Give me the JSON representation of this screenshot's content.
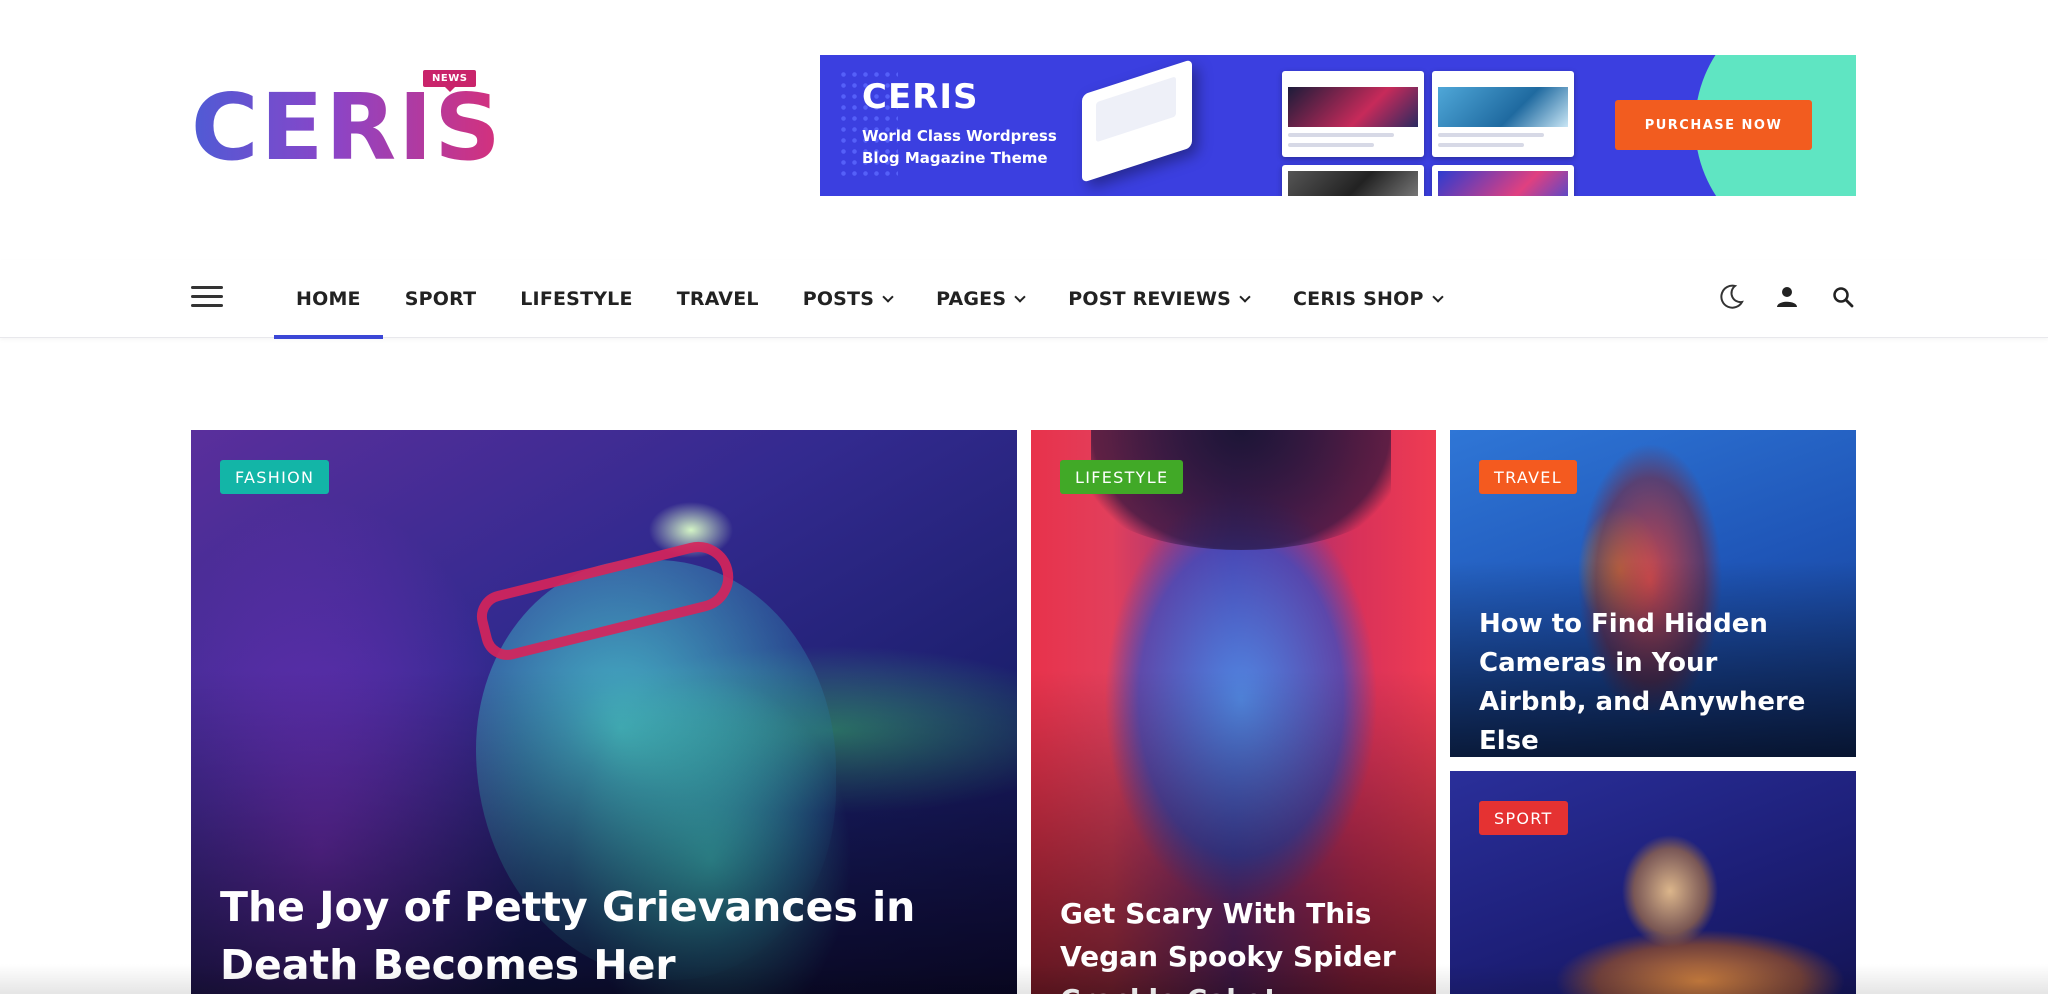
{
  "header": {
    "logo_text": "CERIS",
    "logo_badge": "NEWS"
  },
  "ad": {
    "title": "CERIS",
    "subtitle": "World Class Wordpress Blog Magazine Theme",
    "cta": "PURCHASE NOW"
  },
  "nav": {
    "items": [
      {
        "label": "HOME",
        "active": true,
        "dropdown": false
      },
      {
        "label": "SPORT",
        "active": false,
        "dropdown": false
      },
      {
        "label": "LIFESTYLE",
        "active": false,
        "dropdown": false
      },
      {
        "label": "TRAVEL",
        "active": false,
        "dropdown": false
      },
      {
        "label": "POSTS",
        "active": false,
        "dropdown": true
      },
      {
        "label": "PAGES",
        "active": false,
        "dropdown": true
      },
      {
        "label": "POST REVIEWS",
        "active": false,
        "dropdown": true
      },
      {
        "label": "CERIS SHOP",
        "active": false,
        "dropdown": true
      }
    ],
    "icons": [
      "moon-icon",
      "user-icon",
      "search-icon"
    ]
  },
  "posts": {
    "main": {
      "category": "FASHION",
      "title": "The Joy of Petty Grievances in Death Becomes Her"
    },
    "mid": {
      "category": "LIFESTYLE",
      "title": "Get Scary With This Vegan Spooky Spider Crackle Cake!"
    },
    "top_right": {
      "category": "TRAVEL",
      "title": "How to Find Hidden Cameras in Your Airbnb, and Anywhere Else"
    },
    "bottom_right": {
      "category": "SPORT",
      "title": ""
    }
  },
  "colors": {
    "accent": "#3b47d6",
    "fashion": "#13b5a7",
    "lifestyle": "#41a927",
    "travel": "#f45a1f",
    "sport": "#e53232",
    "cta": "#f25c1f"
  }
}
